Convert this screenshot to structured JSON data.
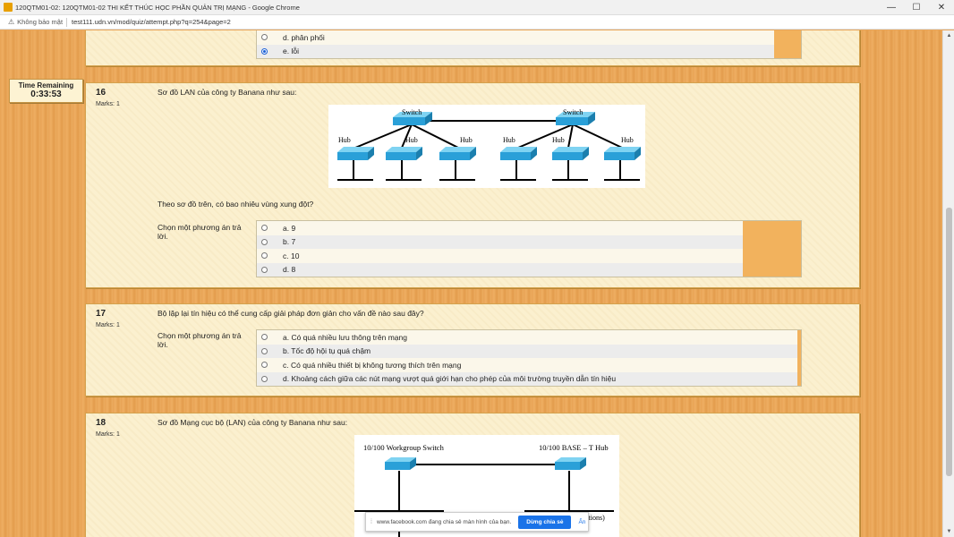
{
  "window": {
    "title": "120QTM01-02: 120QTM01-02 THI KẾT THÚC HỌC PHẦN QUẢN TRỊ MẠNG - Google Chrome",
    "security_label": "Không bảo mật",
    "url": "test111.udn.vn/mod/quiz/attempt.php?q=254&page=2",
    "controls": [
      "—",
      "☐",
      "✕"
    ]
  },
  "timer": {
    "label": "Time Remaining",
    "value": "0:33:53"
  },
  "prev_question": {
    "options": [
      {
        "label": "d. phân phối",
        "selected": false
      },
      {
        "label": "e. lỗi",
        "selected": true
      }
    ]
  },
  "questions": [
    {
      "number": "16",
      "marks": "Marks: 1",
      "text": "Sơ đồ LAN của công ty Banana như sau:",
      "followup": "Theo sơ đồ trên, có bao nhiêu vùng xung đột?",
      "prompt": "Chọn một phương án trả lời.",
      "diagram": {
        "switch_label": "Switch",
        "hub_label": "Hub"
      },
      "options": [
        {
          "label": "a. 9",
          "selected": false
        },
        {
          "label": "b. 7",
          "selected": false
        },
        {
          "label": "c. 10",
          "selected": false
        },
        {
          "label": "d. 8",
          "selected": false
        }
      ]
    },
    {
      "number": "17",
      "marks": "Marks: 1",
      "text": "Bộ lặp lại tín hiệu có thể cung cấp giải pháp đơn giản cho vấn đề nào sau đây?",
      "prompt": "Chọn một phương án trả lời.",
      "options": [
        {
          "label": "a. Có quá nhiều lưu thông trên mạng",
          "selected": false
        },
        {
          "label": "b. Tốc độ hội tụ quá chậm",
          "selected": false
        },
        {
          "label": "c. Có quá nhiều thiết bị không tương thích trên mạng",
          "selected": false
        },
        {
          "label": "d. Khoảng cách giữa các nút mạng vượt quá giới hạn cho phép của môi trường truyền dẫn tín hiệu",
          "selected": false
        }
      ]
    },
    {
      "number": "18",
      "marks": "Marks: 1",
      "text": "Sơ đồ Mạng cục bộ (LAN) của công ty Banana như sau:",
      "diagram": {
        "left_label": "10/100 Workgroup Switch",
        "right_label": "10/100 BASE – T Hub",
        "bottom_fragment": "ations)"
      }
    }
  ],
  "share_bar": {
    "message": "www.facebook.com đang chia sẻ màn hình của bạn.",
    "stop_label": "Dừng chia sẻ",
    "hide_label": "Ẩn"
  },
  "colors": {
    "switch": "#2aa0d8",
    "card": "#fbf0cf",
    "background": "#e9a65a",
    "accent": "#1a73e8"
  }
}
